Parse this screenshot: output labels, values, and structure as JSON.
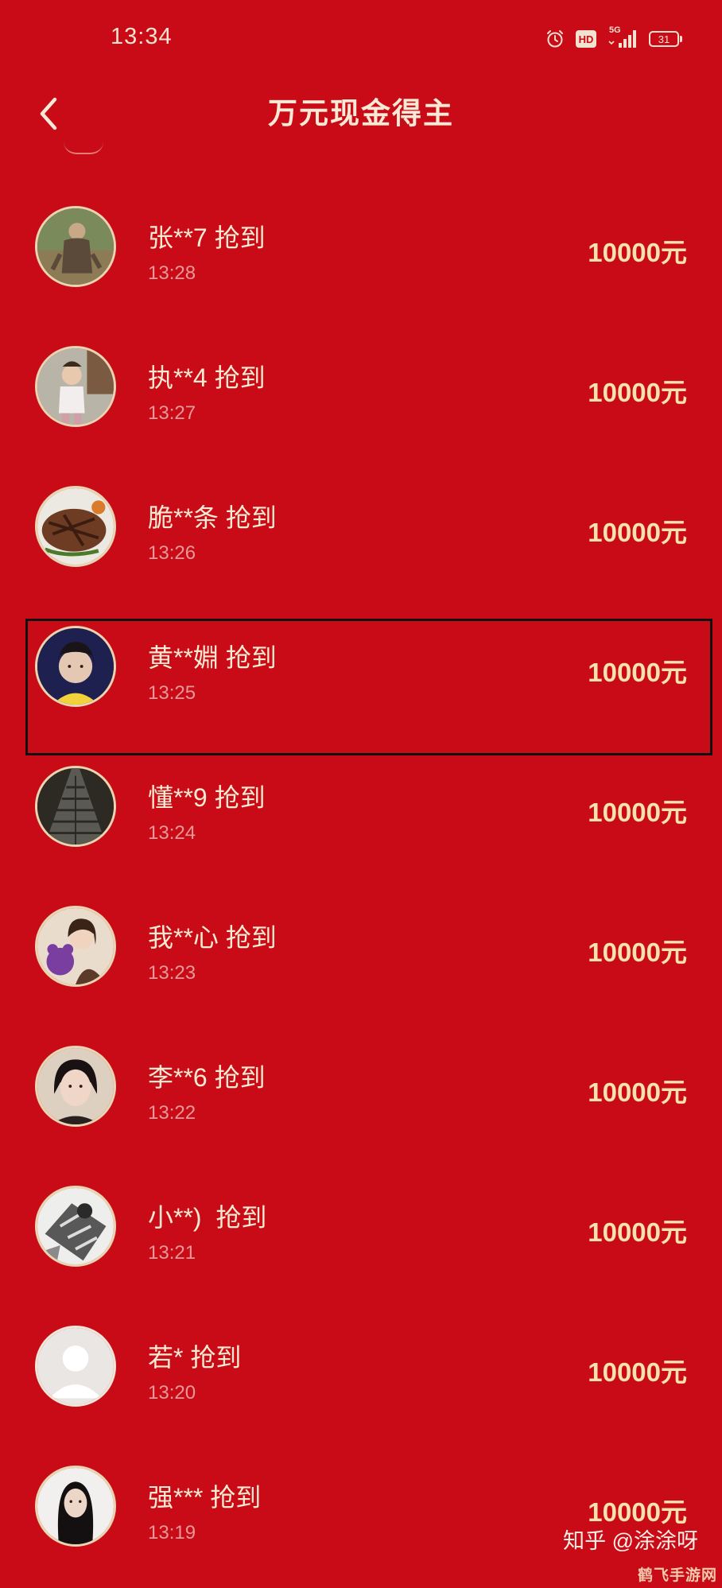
{
  "status_bar": {
    "time": "13:34",
    "network": "5G",
    "hd": "HD",
    "battery": "31"
  },
  "header": {
    "title": "万元现金得主"
  },
  "winners": [
    {
      "name": "张**7 抢到",
      "time": "13:28",
      "amount": "10000元",
      "avatar": "man-photo"
    },
    {
      "name": "执**4 抢到",
      "time": "13:27",
      "amount": "10000元",
      "avatar": "child-photo"
    },
    {
      "name": "脆**条 抢到",
      "time": "13:26",
      "amount": "10000元",
      "avatar": "steak-photo"
    },
    {
      "name": "黄**婣 抢到",
      "time": "13:25",
      "amount": "10000元",
      "avatar": "woman-selfie",
      "highlighted": true
    },
    {
      "name": "懂**9 抢到",
      "time": "13:24",
      "amount": "10000元",
      "avatar": "path-photo"
    },
    {
      "name": "我**心 抢到",
      "time": "13:23",
      "amount": "10000元",
      "avatar": "woman-with-bear"
    },
    {
      "name": "李**6 抢到",
      "time": "13:22",
      "amount": "10000元",
      "avatar": "woman-portrait"
    },
    {
      "name": "小**)  抢到",
      "time": "13:21",
      "amount": "10000元",
      "avatar": "cat-sketch"
    },
    {
      "name": "若* 抢到",
      "time": "13:20",
      "amount": "10000元",
      "avatar": "default-avatar"
    },
    {
      "name": "强*** 抢到",
      "time": "13:19",
      "amount": "10000元",
      "avatar": "woman-long-hair"
    }
  ],
  "watermark": "知乎 @涂涂呀",
  "site_mark": "鹤飞手游网",
  "colors": {
    "background": "#c90b18",
    "name_text": "#f7ead2",
    "time_text": "#e69998",
    "amount_text": "#f6e2ad",
    "avatar_border": "#e9d5b2",
    "highlight_border": "#111111"
  },
  "icons": {
    "back": "chevron-left-icon",
    "alarm": "alarm-icon",
    "hd": "hd-icon",
    "signal": "signal-icon",
    "battery": "battery-icon"
  }
}
